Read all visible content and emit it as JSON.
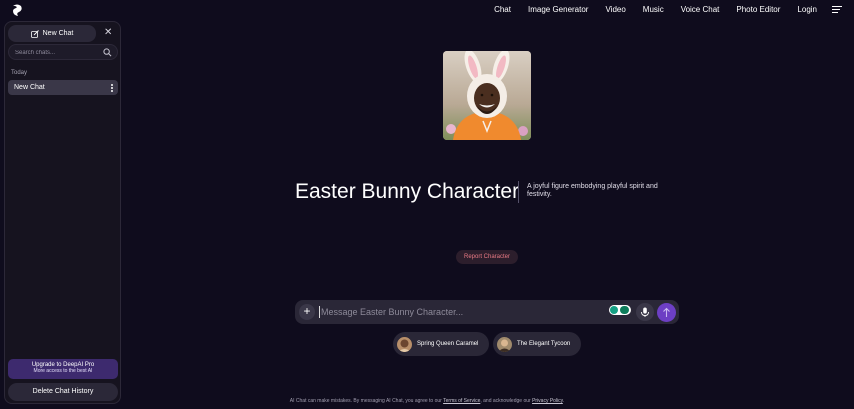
{
  "nav": {
    "items": [
      "Chat",
      "Image Generator",
      "Video",
      "Music",
      "Voice Chat",
      "Photo Editor",
      "Login"
    ]
  },
  "sidebar": {
    "new_chat_label": "New Chat",
    "search_placeholder": "Search chats...",
    "section_today": "Today",
    "chats": [
      "New Chat"
    ],
    "upgrade_title": "Upgrade to DeepAI Pro",
    "upgrade_subtitle": "More access to the best AI",
    "delete_history_label": "Delete Chat History"
  },
  "character": {
    "name": "Easter Bunny Character",
    "description": "A joyful figure embodying playful spirit and festivity.",
    "report_label": "Report Character"
  },
  "composer": {
    "placeholder": "Message Easter Bunny Character..."
  },
  "suggestions": [
    "Spring Queen Caramel",
    "The Elegant Tycoon"
  ],
  "footer": {
    "text_before": "AI Chat can make mistakes. By messaging AI Chat, you agree to our ",
    "terms_link": "Terms of Service",
    "text_middle": ", and acknowledge our ",
    "privacy_link": "Privacy Policy",
    "text_after": "."
  },
  "colors": {
    "background": "#0f0c1d",
    "accent": "#6d3fc4",
    "report_text": "#e97a85"
  }
}
